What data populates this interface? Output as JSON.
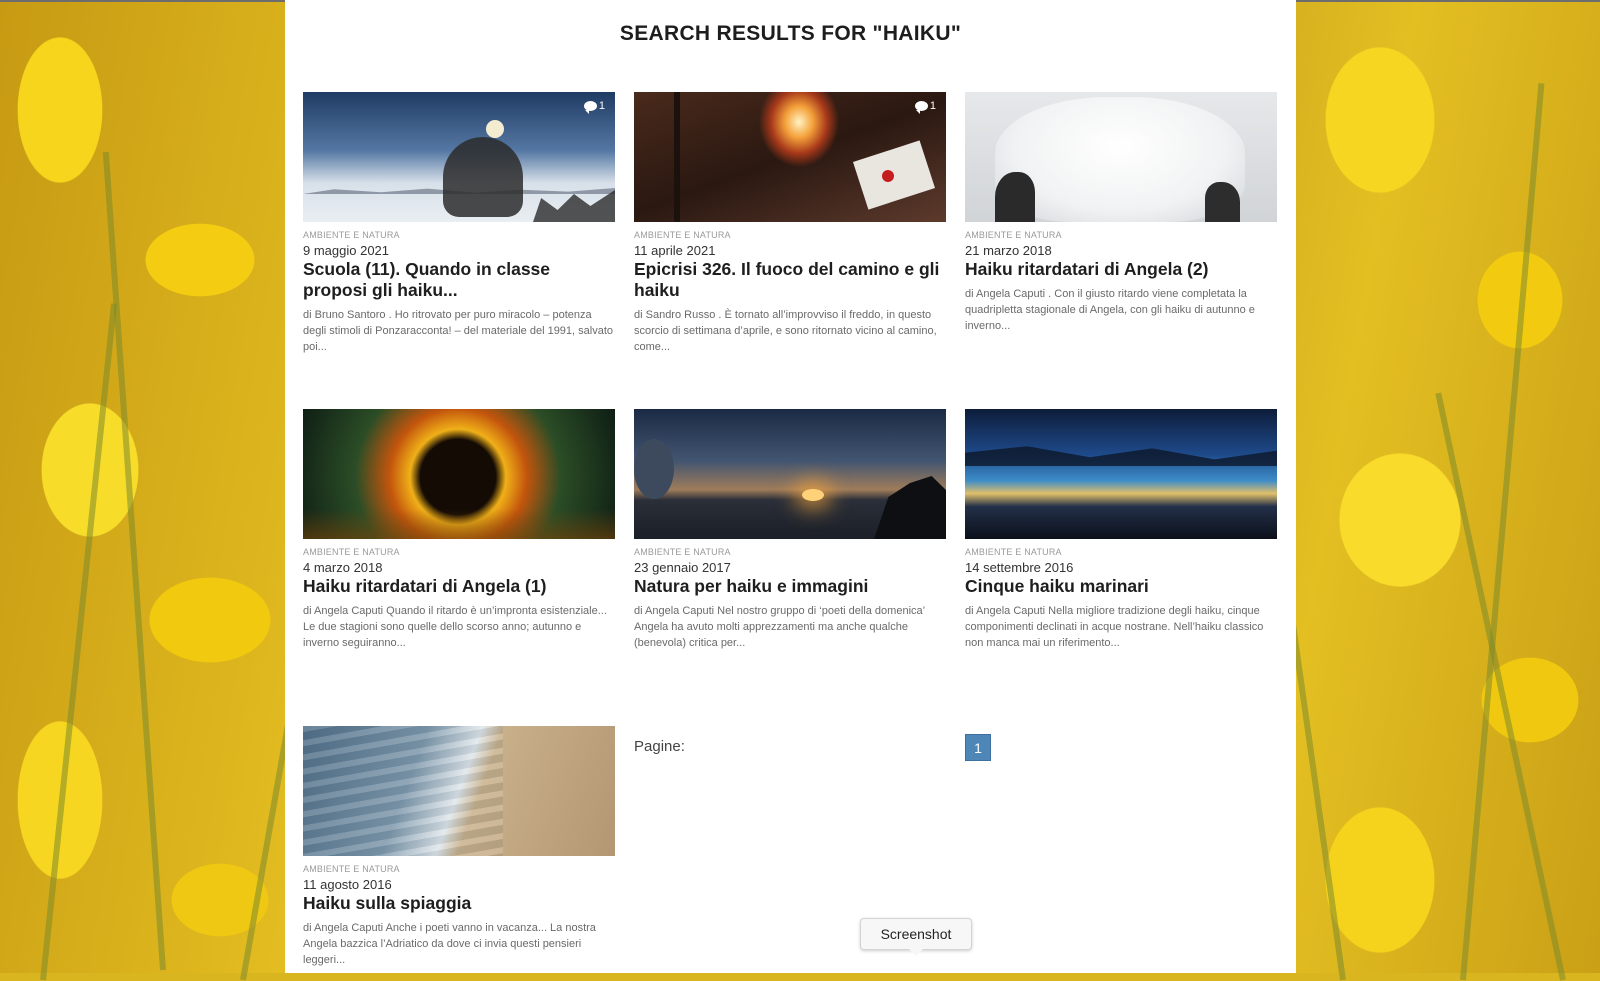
{
  "page": {
    "heading": "SEARCH RESULTS FOR \"HAIKU\"",
    "pagination_label": "Pagine:",
    "current_page": "1"
  },
  "results": [
    {
      "category": "AMBIENTE E NATURA",
      "date": "9 maggio 2021",
      "title": "Scuola (11). Quando in classe proposi gli haiku...",
      "excerpt": "di Bruno Santoro . Ho ritrovato per puro miracolo – potenza degli stimoli di Ponzaracconta! – del materiale del 1991, salvato poi...",
      "comments": "1"
    },
    {
      "category": "AMBIENTE E NATURA",
      "date": "11 aprile 2021",
      "title": "Epicrisi 326. Il fuoco del camino e gli haiku",
      "excerpt": "di Sandro Russo . È tornato all’improvviso il freddo, in questo scorcio di settimana d’aprile, e sono ritornato vicino al camino, come...",
      "comments": "1"
    },
    {
      "category": "AMBIENTE E NATURA",
      "date": "21 marzo 2018",
      "title": "Haiku ritardatari di Angela (2)",
      "excerpt": "di Angela Caputi . Con il giusto ritardo viene completata la quadripletta stagionale di Angela, con gli haiku di autunno e inverno...",
      "comments": ""
    },
    {
      "category": "AMBIENTE E NATURA",
      "date": "4 marzo 2018",
      "title": "Haiku ritardatari di Angela (1)",
      "excerpt": "di Angela Caputi   Quando il ritardo è un’impronta esistenziale... Le due stagioni sono quelle dello scorso anno; autunno e inverno seguiranno...",
      "comments": ""
    },
    {
      "category": "AMBIENTE E NATURA",
      "date": "23 gennaio 2017",
      "title": "Natura per haiku e immagini",
      "excerpt": "di Angela Caputi   Nel nostro gruppo di ‘poeti della domenica’ Angela ha avuto molti apprezzamenti ma anche qualche (benevola) critica per...",
      "comments": ""
    },
    {
      "category": "AMBIENTE E NATURA",
      "date": "14 settembre 2016",
      "title": "Cinque haiku marinari",
      "excerpt": "di Angela Caputi   Nella migliore tradizione degli haiku, cinque componimenti declinati in acque nostrane. Nell’haiku classico non manca mai un riferimento...",
      "comments": ""
    },
    {
      "category": "AMBIENTE E NATURA",
      "date": "11 agosto 2016",
      "title": "Haiku sulla spiaggia",
      "excerpt": "di Angela Caputi   Anche i poeti vanno in vacanza... La nostra Angela bazzica l’Adriatico da dove ci invia questi pensieri leggeri...",
      "comments": ""
    }
  ],
  "tooltip": "Screenshot"
}
